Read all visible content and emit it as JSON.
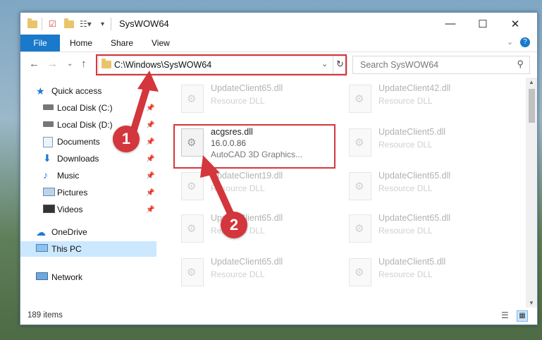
{
  "window": {
    "title": "SysWOW64"
  },
  "ribbon": {
    "tabs": [
      "File",
      "Home",
      "Share",
      "View"
    ]
  },
  "address": {
    "path": "C:\\Windows\\SysWOW64"
  },
  "search": {
    "placeholder": "Search SysWOW64"
  },
  "sidebar": {
    "items": [
      {
        "label": "Quick access",
        "icon": "star-icon"
      },
      {
        "label": "Local Disk (C:)",
        "icon": "drive-icon"
      },
      {
        "label": "Local Disk (D:)",
        "icon": "drive-icon"
      },
      {
        "label": "Documents",
        "icon": "documents-icon"
      },
      {
        "label": "Downloads",
        "icon": "download-icon"
      },
      {
        "label": "Music",
        "icon": "music-icon"
      },
      {
        "label": "Pictures",
        "icon": "pictures-icon"
      },
      {
        "label": "Videos",
        "icon": "videos-icon"
      },
      {
        "label": "OneDrive",
        "icon": "cloud-icon"
      },
      {
        "label": "This PC",
        "icon": "computer-icon"
      },
      {
        "label": "Network",
        "icon": "network-icon"
      }
    ]
  },
  "files": [
    {
      "name": "UpdateClient65.dll",
      "desc": "Resource DLL"
    },
    {
      "name": "UpdateClient42.dll",
      "desc": "Resource DLL"
    },
    {
      "name": "acgsres.dll",
      "version": "16.0.0.86",
      "desc": "AutoCAD 3D Graphics..."
    },
    {
      "name": "UpdateClient5.dll",
      "desc": "Resource DLL"
    },
    {
      "name": "UpdateClient19.dll",
      "desc": "Resource DLL"
    },
    {
      "name": "UpdateClient65.dll",
      "desc": "Resource DLL"
    },
    {
      "name": "UpdateClient65.dll",
      "desc": "Resource DLL"
    },
    {
      "name": "UpdateClient65.dll",
      "desc": "Resource DLL"
    },
    {
      "name": "UpdateClient65.dll",
      "desc": "Resource DLL"
    },
    {
      "name": "UpdateClient5.dll",
      "desc": "Resource DLL"
    }
  ],
  "annotations": {
    "step1": "1",
    "step2": "2",
    "color": "#d3363c"
  },
  "status": {
    "count": "189 items"
  }
}
